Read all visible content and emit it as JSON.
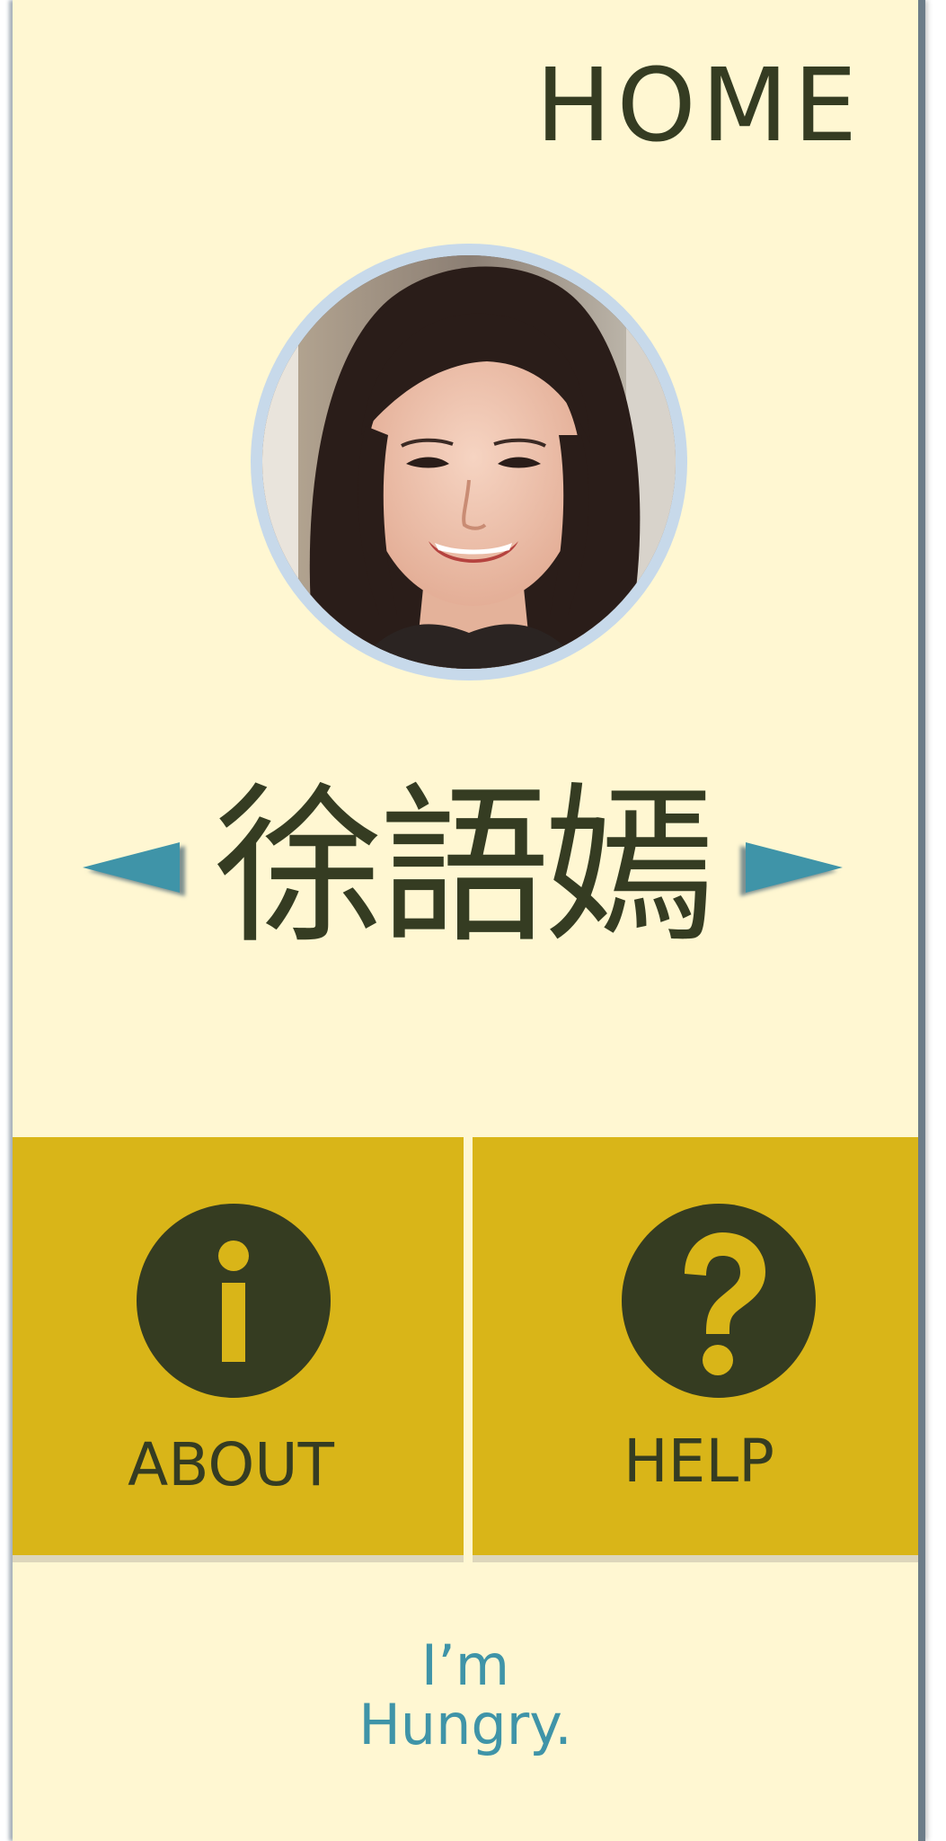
{
  "header": {
    "title": "HOME"
  },
  "profile": {
    "name": "徐語嫣",
    "avatar_icon": "profile-photo",
    "ring_color": "#c7d9ea"
  },
  "navigation": {
    "prev_icon": "triangle-left-icon",
    "next_icon": "triangle-right-icon",
    "arrow_color": "#3f94a8"
  },
  "tiles": [
    {
      "id": "about",
      "label": "ABOUT",
      "icon": "info-icon"
    },
    {
      "id": "help",
      "label": "HELP",
      "icon": "question-icon"
    }
  ],
  "footer": {
    "line1": "I’m",
    "line2": "Hungry."
  },
  "colors": {
    "background": "#fff7d2",
    "tile": "#d9b518",
    "text_dark": "#353c22",
    "accent": "#3f94a8"
  }
}
